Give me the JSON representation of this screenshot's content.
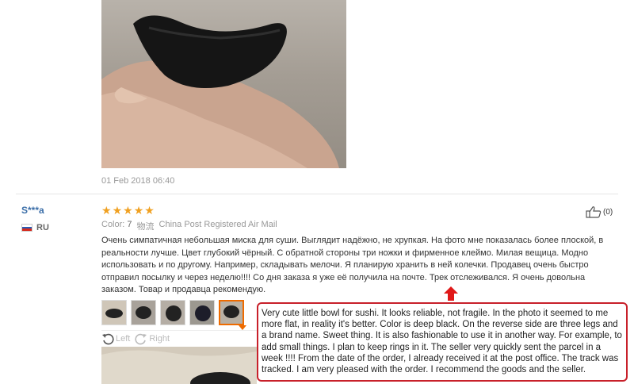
{
  "top_review": {
    "date": "01 Feb 2018 06:40"
  },
  "review": {
    "user_name": "S***a",
    "country_code": "RU",
    "stars": [
      "★",
      "★",
      "★",
      "★",
      "★"
    ],
    "likes": "(0)",
    "color_label": "Color:",
    "color_value": "7",
    "shipping_label": "物流",
    "shipping_value": "China Post Registered Air Mail",
    "text": "Очень симпатичная небольшая миска для суши. Выглядит надёжно, не хрупкая. На фото мне показалась более плоской, в реальности лучше. Цвет глубокий чёрный. С обратной стороны три ножки и фирменное клеймо. Милая вещица. Модно использовать и по другому. Например, складывать мелочи. Я планирую хранить в ней колечки. Продавец очень быстро отправил посылку и через неделю!!!! Со дня заказа я уже её получила на почте. Трек отслеживался. Я очень довольна заказом. Товар и продавца рекомендую.",
    "nav_left": "Left",
    "nav_right": "Right"
  },
  "translation": "Very cute little bowl for sushi. It looks reliable, not fragile. In the photo it seemed to me more flat, in reality it's better. Color is deep black. On the reverse side are three legs and a brand name. Sweet thing. It is also fashionable to use it in another way. For example, to add small things. I plan to keep rings in it. The seller very quickly sent the parcel in a week !!!! From the date of the order, I already received it at the post office. The track was tracked. I am very pleased with the order. I recommend the goods and the seller.",
  "colors": {
    "accent_orange": "#ee6b00",
    "annotation_red": "#c8202a",
    "star": "#f0a020",
    "username": "#3b6ea8"
  },
  "icons": [
    "thumbs-up-icon",
    "rotate-left-icon",
    "rotate-right-icon",
    "red-arrow-up-icon",
    "ru-flag-icon"
  ]
}
